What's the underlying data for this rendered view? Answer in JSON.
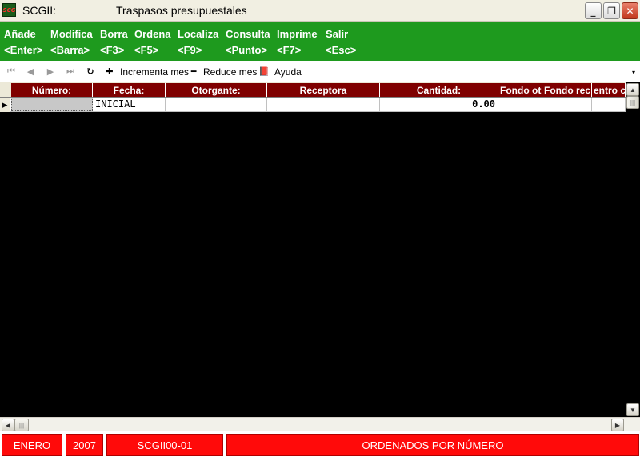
{
  "window": {
    "app_name": "SCGII:",
    "title": "Traspasos presupuestales",
    "icon_text": "SCG",
    "min_glyph": "_",
    "max_glyph": "❐",
    "close_glyph": "✕"
  },
  "menu": [
    {
      "label": "Añade",
      "key": "<Enter>"
    },
    {
      "label": "Modifica",
      "key": "<Barra>"
    },
    {
      "label": "Borra",
      "key": "<F3>"
    },
    {
      "label": "Ordena",
      "key": "<F5>"
    },
    {
      "label": "Localiza",
      "key": "<F9>"
    },
    {
      "label": "Consulta",
      "key": "<Punto>"
    },
    {
      "label": "Imprime",
      "key": "<F7>"
    },
    {
      "label": "Salir",
      "key": "<Esc>"
    }
  ],
  "toolbar": {
    "first_glyph": "⏮",
    "prev_glyph": "◀",
    "next_glyph": "▶",
    "last_glyph": "⏭",
    "refresh_glyph": "↻",
    "increment_glyph": "✚",
    "increment_label": "Incrementa mes",
    "reduce_glyph": "━",
    "reduce_label": "Reduce mes",
    "help_glyph": "📕",
    "help_label": "Ayuda",
    "dropdown_glyph": "▾"
  },
  "grid": {
    "columns": [
      "Número:",
      "Fecha:",
      "Otorgante:",
      "Receptora",
      "Cantidad:",
      "Fondo ot",
      "Fondo rec",
      "entro c"
    ],
    "rows": [
      {
        "numero": "",
        "fecha": "INICIAL",
        "otorgante": "",
        "receptora": "",
        "cantidad": "0.00",
        "fondo_ot": "",
        "fondo_rec": "",
        "centro": ""
      }
    ],
    "row_indicator": "▶"
  },
  "scroll": {
    "up": "▲",
    "down": "▼",
    "left": "◀",
    "right": "▶",
    "grip": "|||"
  },
  "status": {
    "month": "ENERO",
    "year": "2007",
    "code": "SCGII00-01",
    "message": "ORDENADOS POR NÚMERO"
  },
  "colors": {
    "menu_green": "#1e9a1e",
    "header_maroon": "#7f0000",
    "status_red": "#ff0a0a"
  }
}
